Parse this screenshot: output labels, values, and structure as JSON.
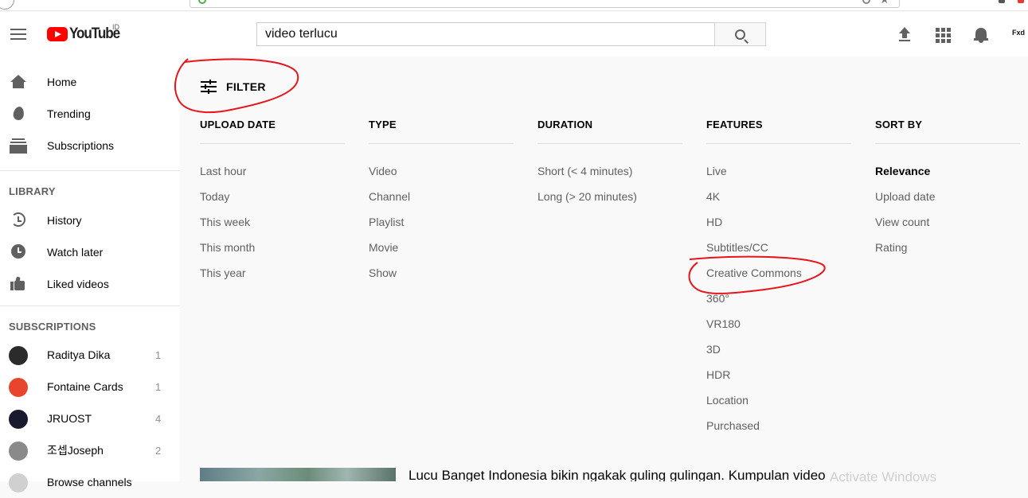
{
  "masthead": {
    "logo_text": "YouTube",
    "country_code": "ID",
    "search_value": "video terlucu",
    "avatar_text": "Fxd"
  },
  "sidebar": {
    "main_items": [
      {
        "label": "Home",
        "icon": "home-icon"
      },
      {
        "label": "Trending",
        "icon": "fire-icon"
      },
      {
        "label": "Subscriptions",
        "icon": "subscriptions-icon"
      }
    ],
    "library_header": "LIBRARY",
    "library_items": [
      {
        "label": "History",
        "icon": "history-icon"
      },
      {
        "label": "Watch later",
        "icon": "clock-icon"
      },
      {
        "label": "Liked videos",
        "icon": "thumbs-up-icon"
      }
    ],
    "subscriptions_header": "SUBSCRIPTIONS",
    "subscriptions": [
      {
        "label": "Raditya Dika",
        "count": "1",
        "color": "#2b2b2b"
      },
      {
        "label": "Fontaine Cards",
        "count": "1",
        "color": "#e8452c"
      },
      {
        "label": "JRUOST",
        "count": "4",
        "color": "#1a1a2e"
      },
      {
        "label": "조셉Joseph",
        "count": "2",
        "color": "#8a8a8a"
      }
    ],
    "browse_channels": "Browse channels"
  },
  "filter": {
    "button_label": "FILTER",
    "columns": [
      {
        "header": "UPLOAD DATE",
        "options": [
          "Last hour",
          "Today",
          "This week",
          "This month",
          "This year"
        ]
      },
      {
        "header": "TYPE",
        "options": [
          "Video",
          "Channel",
          "Playlist",
          "Movie",
          "Show"
        ]
      },
      {
        "header": "DURATION",
        "options": [
          "Short (< 4 minutes)",
          "Long (> 20 minutes)"
        ]
      },
      {
        "header": "FEATURES",
        "options": [
          "Live",
          "4K",
          "HD",
          "Subtitles/CC",
          "Creative Commons",
          "360°",
          "VR180",
          "3D",
          "HDR",
          "Location",
          "Purchased"
        ]
      },
      {
        "header": "SORT BY",
        "options": [
          "Relevance",
          "Upload date",
          "View count",
          "Rating"
        ],
        "active": "Relevance"
      }
    ]
  },
  "result": {
    "title": "Lucu Banget Indonesia bikin ngakak guling gulingan. Kumpulan video"
  },
  "watermark": "Activate Windows",
  "colors": {
    "brand_red": "#ff0000",
    "annotation_red": "#e8141c",
    "text_primary": "#030303",
    "text_secondary": "#606060"
  }
}
